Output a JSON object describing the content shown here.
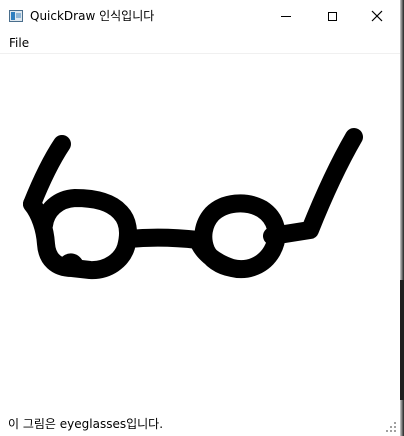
{
  "window": {
    "title": "QuickDraw 인식입니다",
    "icon": "app-window-icon",
    "controls": {
      "minimize_icon": "minimize-icon",
      "maximize_icon": "maximize-icon",
      "close_icon": "close-icon"
    }
  },
  "menubar": {
    "items": [
      {
        "label": "File"
      }
    ]
  },
  "canvas": {
    "drawing_subject": "eyeglasses",
    "stroke_color": "#000000",
    "background_color": "#ffffff"
  },
  "statusbar": {
    "text": "이 그림은 eyeglasses입니다."
  }
}
